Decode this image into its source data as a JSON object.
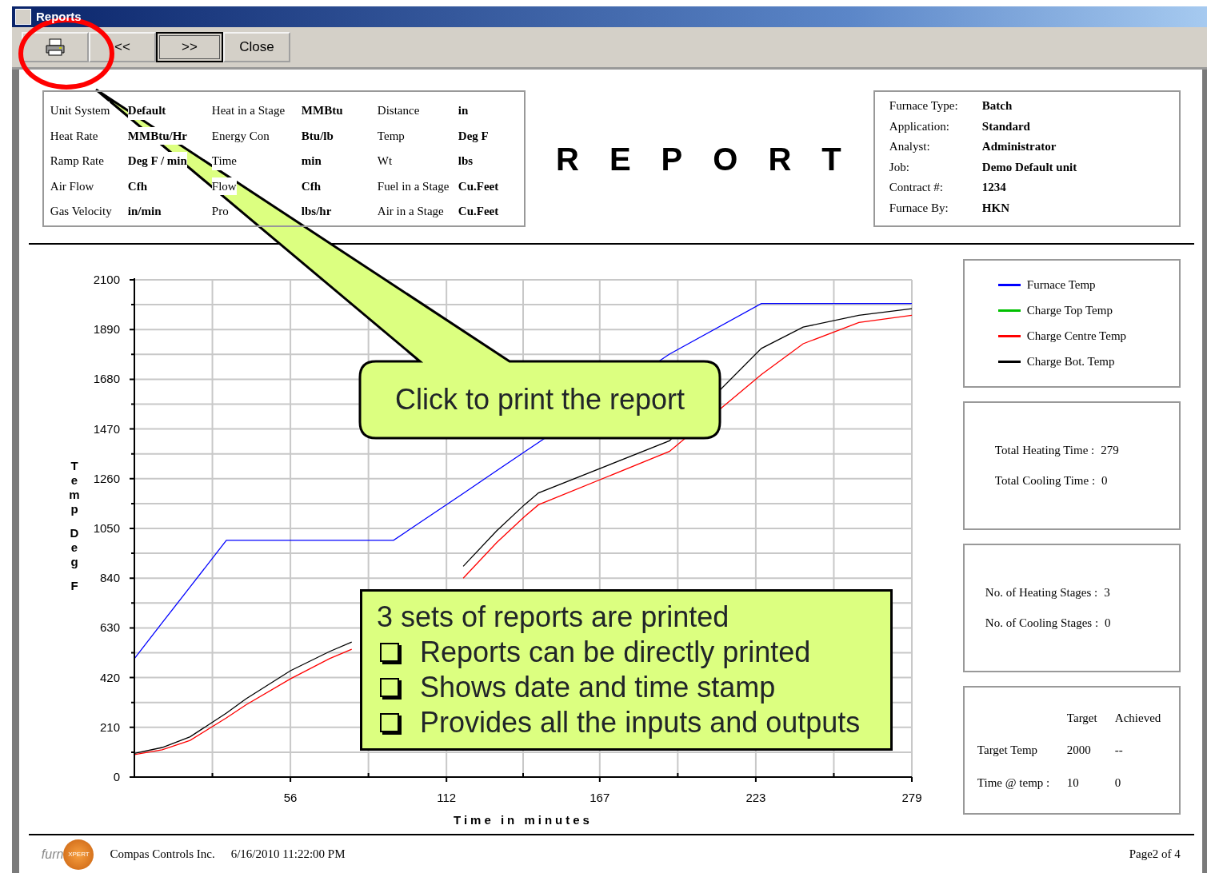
{
  "window": {
    "title": "Reports"
  },
  "toolbar": [
    {
      "kind": "print",
      "focused": false
    },
    {
      "kind": "text",
      "label": "<<",
      "focused": false
    },
    {
      "kind": "text",
      "label": ">>",
      "focused": true
    },
    {
      "kind": "text",
      "label": "Close",
      "focused": false
    }
  ],
  "units": [
    [
      {
        "label": "Unit System",
        "value": "Default"
      },
      {
        "label": "Heat in a Stage",
        "value": "MMBtu"
      },
      {
        "label": "Distance",
        "value": "in"
      }
    ],
    [
      {
        "label": "Heat Rate",
        "value": "MMBtu/Hr"
      },
      {
        "label": "Energy Con",
        "value": "Btu/lb"
      },
      {
        "label": "Temp",
        "value": "Deg F"
      }
    ],
    [
      {
        "label": "Ramp Rate",
        "value": "Deg F / min"
      },
      {
        "label": "Time",
        "value": "min"
      },
      {
        "label": "Wt",
        "value": "lbs"
      }
    ],
    [
      {
        "label": "Air Flow",
        "value": "Cfh"
      },
      {
        "label": "Flow",
        "value": "Cfh"
      },
      {
        "label": "Fuel in a Stage",
        "value": "Cu.Feet"
      }
    ],
    [
      {
        "label": "Gas Velocity",
        "value": "in/min"
      },
      {
        "label": "Pro",
        "value": "lbs/hr"
      },
      {
        "label": "Air in a Stage",
        "value": "Cu.Feet"
      }
    ]
  ],
  "report_title": "REPORT",
  "info": [
    {
      "label": "Furnace Type:",
      "value": "Batch"
    },
    {
      "label": "Application:",
      "value": "Standard"
    },
    {
      "label": "Analyst:",
      "value": "Administrator"
    },
    {
      "label": "Job:",
      "value": "Demo Default unit"
    },
    {
      "label": "Contract #:",
      "value": "1234"
    },
    {
      "label": "Furnace By:",
      "value": "HKN"
    }
  ],
  "chart": {
    "chart_data": {
      "type": "line",
      "grid": true,
      "xlabel": "Time in minutes",
      "ylabel": "Temp Deg F",
      "xlim": [
        0,
        279
      ],
      "ylim": [
        0,
        2100
      ],
      "xticks": [
        56,
        112,
        167,
        223,
        279
      ],
      "yticks": [
        0,
        210,
        420,
        630,
        840,
        1050,
        1260,
        1470,
        1680,
        1890,
        2100
      ],
      "x": [
        0,
        10,
        20,
        33,
        40,
        56,
        70,
        78,
        93,
        118,
        130,
        140,
        145,
        192,
        225,
        240,
        260,
        279
      ],
      "series": [
        {
          "name": "Furnace Temp",
          "color": "#0000ff",
          "values": [
            500,
            652,
            803,
            1000,
            1000,
            1000,
            1000,
            1000,
            1000,
            1198,
            1294,
            1373,
            1413,
            1786,
            2000,
            2000,
            2000,
            2000
          ]
        },
        {
          "name": "Charge Top Temp",
          "color": "#00c000",
          "values": [
            null,
            null,
            null,
            null,
            null,
            null,
            null,
            null,
            null,
            null,
            null,
            null,
            null,
            null,
            null,
            null,
            null,
            null
          ]
        },
        {
          "name": "Charge Centre Temp",
          "color": "#ff0000",
          "values": [
            95,
            115,
            155,
            250,
            305,
            415,
            500,
            540,
            null,
            840,
            990,
            1100,
            1150,
            1375,
            1700,
            1830,
            1920,
            1950
          ]
        },
        {
          "name": "Charge Bot. Temp",
          "color": "#000000",
          "values": [
            100,
            125,
            170,
            270,
            330,
            449,
            530,
            570,
            null,
            890,
            1040,
            1150,
            1200,
            1420,
            1810,
            1900,
            1950,
            1978
          ]
        }
      ]
    }
  },
  "times": [
    {
      "label": "Total Heating Time :",
      "value": "279"
    },
    {
      "label": "Total Cooling Time :",
      "value": "0"
    }
  ],
  "stages": [
    {
      "label": "No. of Heating Stages :",
      "value": "3"
    },
    {
      "label": "No. of Cooling Stages :",
      "value": "0"
    }
  ],
  "targets": {
    "columns": [
      "Target",
      "Achieved"
    ],
    "rows": [
      {
        "label": "Target Temp",
        "target": "2000",
        "achieved": "--"
      },
      {
        "label": "Time @ temp :",
        "target": "10",
        "achieved": "0"
      }
    ]
  },
  "footer": {
    "logo_text": "furn",
    "logo_badge": "XPERT",
    "company": "Compas Controls Inc.",
    "datetime": "6/16/2010 11:22:00 PM",
    "page": "Page2 of 4"
  },
  "callouts": [
    {
      "kind": "arrow",
      "text": "Click to print the report"
    },
    {
      "kind": "box",
      "text": "3 sets of reports are printed",
      "bullets": [
        "Reports can be directly printed",
        "Shows date and time stamp",
        "Provides all the inputs and outputs"
      ]
    }
  ]
}
